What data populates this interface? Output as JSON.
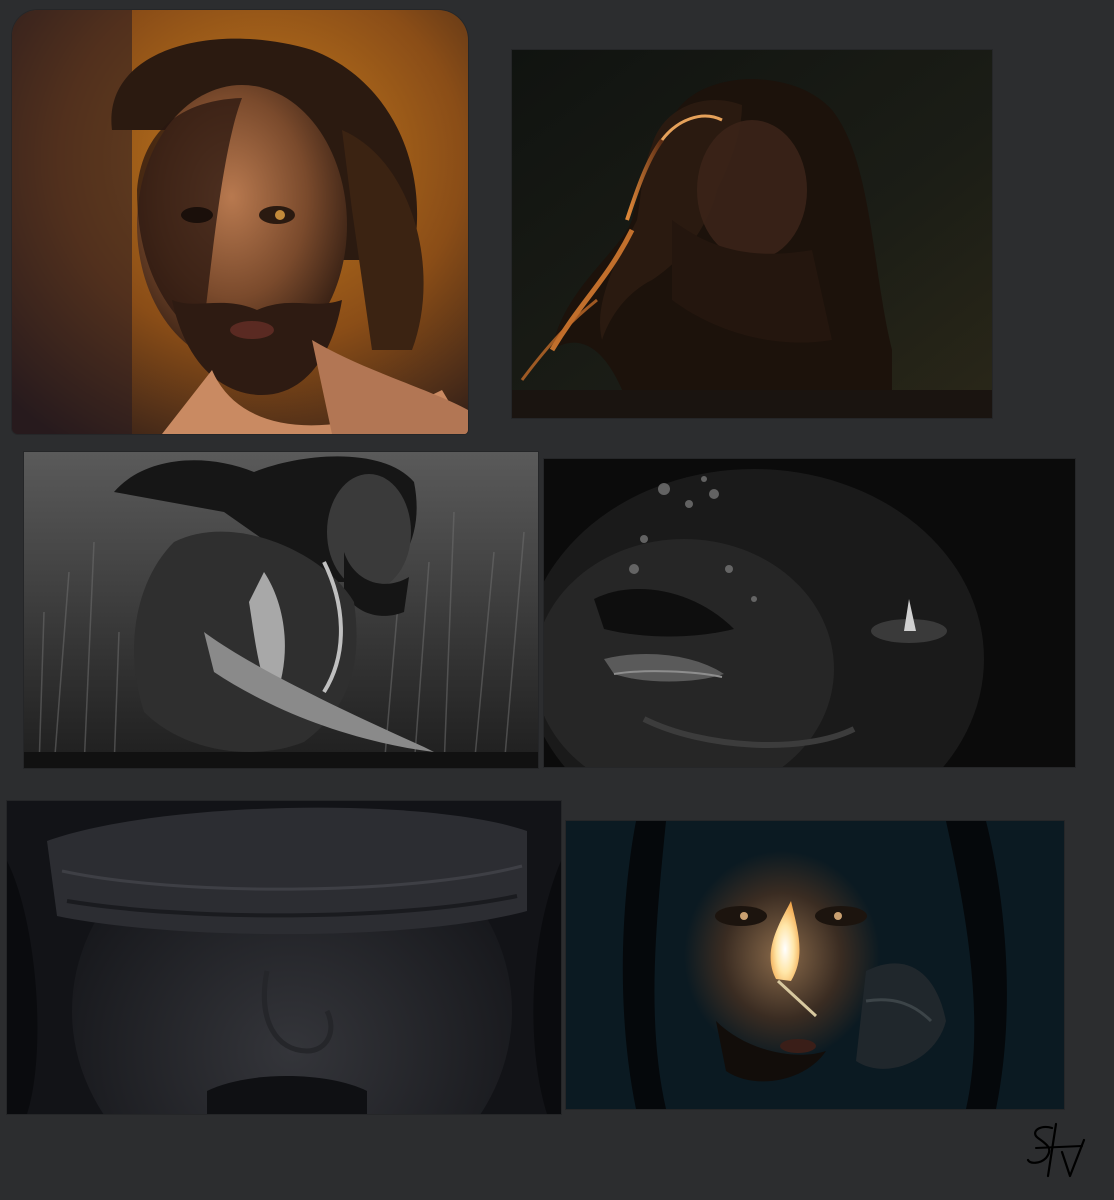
{
  "canvas": {
    "background": "#2c2d2f"
  },
  "panels": [
    {
      "subject": "bearded-man-portrait-warm-light",
      "palette": [
        "#c0771d",
        "#6a3d1a",
        "#2a1a12"
      ]
    },
    {
      "subject": "man-head-tilted-back-rim-light",
      "palette": [
        "#121410",
        "#d0782c",
        "#1e1a12"
      ]
    },
    {
      "subject": "man-crouching-in-tall-grass-greyscale",
      "palette": [
        "#4a4a4a",
        "#9a9a9a",
        "#0e0e0e"
      ]
    },
    {
      "subject": "dark-face-close-up-eyes-closed",
      "palette": [
        "#0a0a0a",
        "#3a3a3a",
        "#8a8a8a"
      ]
    },
    {
      "subject": "blindfolded-man-close-up-dark",
      "palette": [
        "#151619",
        "#2a2b30",
        "#3a3b40"
      ]
    },
    {
      "subject": "man-lighting-match-at-nose",
      "palette": [
        "#0b1a22",
        "#6a4a30",
        "#ffe9b0"
      ]
    }
  ],
  "signature": {
    "icon": "artist-signature-icon",
    "color": "#000000"
  }
}
